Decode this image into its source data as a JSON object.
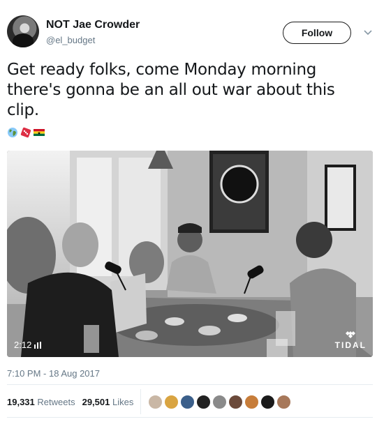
{
  "user": {
    "name": "NOT Jae Crowder",
    "handle": "@el_budget"
  },
  "follow_label": "Follow",
  "tweet": {
    "text": "Get ready folks, come Monday morning there's gonna be an all out war about this clip.",
    "emoji_icons": [
      "globe-icon",
      "dice-icon",
      "ghana-flag-icon"
    ]
  },
  "media": {
    "duration": "2:12",
    "watermark": "TIDAL"
  },
  "timestamp": "7:10 PM - 18 Aug 2017",
  "stats": {
    "retweets_count": "19,331",
    "retweets_label": "Retweets",
    "likes_count": "29,501",
    "likes_label": "Likes"
  },
  "likers": [
    "#c9b7a5",
    "#d9a441",
    "#3b5f8a",
    "#222222",
    "#8a8a8a",
    "#6b4a3a",
    "#c77d3a",
    "#1a1a1a",
    "#a7785a"
  ]
}
